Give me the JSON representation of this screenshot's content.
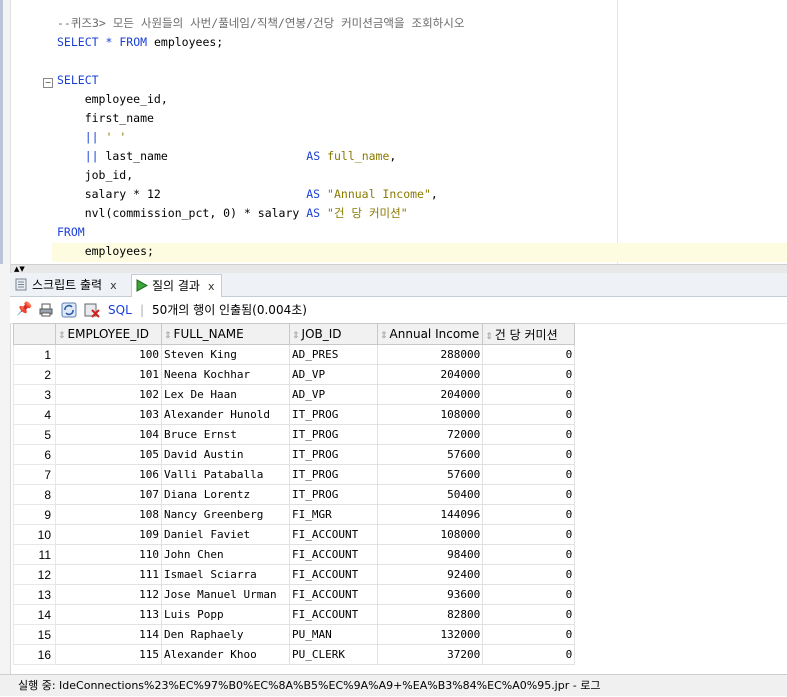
{
  "editor": {
    "lines": [
      {
        "segments": [
          {
            "t": "--퀴즈3> 모든 사원들의 사번/풀네임/직책/연봉/건당 커미션금액을 조회하시오",
            "c": "cm"
          }
        ]
      },
      {
        "segments": [
          {
            "t": "SELECT",
            "c": "kw"
          },
          {
            "t": " "
          },
          {
            "t": "*",
            "c": "kw"
          },
          {
            "t": " "
          },
          {
            "t": "FROM",
            "c": "kw"
          },
          {
            "t": " employees;"
          }
        ]
      },
      {
        "segments": [
          {
            "t": ""
          }
        ]
      },
      {
        "segments": [
          {
            "t": "SELECT",
            "c": "kw"
          }
        ]
      },
      {
        "segments": [
          {
            "t": "    employee_id,"
          }
        ]
      },
      {
        "segments": [
          {
            "t": "    first_name"
          }
        ]
      },
      {
        "segments": [
          {
            "t": "    "
          },
          {
            "t": "||",
            "c": "kw"
          },
          {
            "t": " "
          },
          {
            "t": "' '",
            "c": "str"
          }
        ]
      },
      {
        "segments": [
          {
            "t": "    "
          },
          {
            "t": "||",
            "c": "kw"
          },
          {
            "t": " last_name                    "
          },
          {
            "t": "AS",
            "c": "kw"
          },
          {
            "t": " "
          },
          {
            "t": "full_name",
            "c": "str"
          },
          {
            "t": ","
          }
        ]
      },
      {
        "segments": [
          {
            "t": "    job_id,"
          }
        ]
      },
      {
        "segments": [
          {
            "t": "    salary * 12                     "
          },
          {
            "t": "AS",
            "c": "kw"
          },
          {
            "t": " "
          },
          {
            "t": "\"Annual Income\"",
            "c": "str"
          },
          {
            "t": ","
          }
        ]
      },
      {
        "segments": [
          {
            "t": "    nvl(commission_pct, 0) * salary "
          },
          {
            "t": "AS",
            "c": "kw"
          },
          {
            "t": " "
          },
          {
            "t": "\"건 당 커미션\"",
            "c": "str"
          }
        ]
      },
      {
        "segments": [
          {
            "t": "FROM",
            "c": "kw"
          }
        ]
      },
      {
        "segments": [
          {
            "t": "    employees;"
          }
        ]
      }
    ]
  },
  "tabs": {
    "script_output": "스크립트 출력",
    "query_result": "질의 결과",
    "close": "x"
  },
  "toolbar": {
    "sql_label": "SQL",
    "separator": "|",
    "status": "50개의 행이 인출됨(0.004초)"
  },
  "grid": {
    "columns": [
      "EMPLOYEE_ID",
      "FULL_NAME",
      "JOB_ID",
      "Annual Income",
      "건 당 커미션"
    ],
    "rows": [
      [
        "1",
        "100",
        "Steven King",
        "AD_PRES",
        "288000",
        "0"
      ],
      [
        "2",
        "101",
        "Neena Kochhar",
        "AD_VP",
        "204000",
        "0"
      ],
      [
        "3",
        "102",
        "Lex De Haan",
        "AD_VP",
        "204000",
        "0"
      ],
      [
        "4",
        "103",
        "Alexander Hunold",
        "IT_PROG",
        "108000",
        "0"
      ],
      [
        "5",
        "104",
        "Bruce Ernst",
        "IT_PROG",
        "72000",
        "0"
      ],
      [
        "6",
        "105",
        "David Austin",
        "IT_PROG",
        "57600",
        "0"
      ],
      [
        "7",
        "106",
        "Valli Pataballa",
        "IT_PROG",
        "57600",
        "0"
      ],
      [
        "8",
        "107",
        "Diana Lorentz",
        "IT_PROG",
        "50400",
        "0"
      ],
      [
        "9",
        "108",
        "Nancy Greenberg",
        "FI_MGR",
        "144096",
        "0"
      ],
      [
        "10",
        "109",
        "Daniel Faviet",
        "FI_ACCOUNT",
        "108000",
        "0"
      ],
      [
        "11",
        "110",
        "John Chen",
        "FI_ACCOUNT",
        "98400",
        "0"
      ],
      [
        "12",
        "111",
        "Ismael Sciarra",
        "FI_ACCOUNT",
        "92400",
        "0"
      ],
      [
        "13",
        "112",
        "Jose Manuel Urman",
        "FI_ACCOUNT",
        "93600",
        "0"
      ],
      [
        "14",
        "113",
        "Luis Popp",
        "FI_ACCOUNT",
        "82800",
        "0"
      ],
      [
        "15",
        "114",
        "Den Raphaely",
        "PU_MAN",
        "132000",
        "0"
      ],
      [
        "16",
        "115",
        "Alexander Khoo",
        "PU_CLERK",
        "37200",
        "0"
      ]
    ]
  },
  "statusbar": {
    "text": "실행 중: IdeConnections%23%EC%97%B0%EC%8A%B5%EC%9A%A9+%EA%B3%84%EC%A0%95.jpr - 로그"
  },
  "colors": {
    "keyword": "#1a3fd6",
    "comment": "#6c6c6c",
    "string": "#8a7a00"
  }
}
